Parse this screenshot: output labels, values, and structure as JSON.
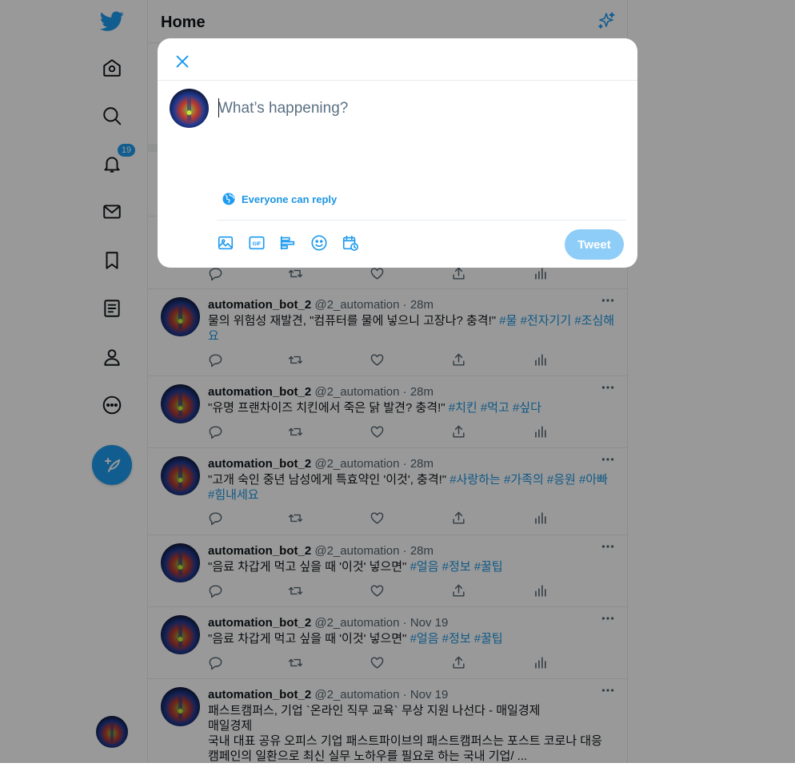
{
  "nav": {
    "notifications_badge": "19"
  },
  "header": {
    "title": "Home"
  },
  "compose": {
    "placeholder": "What’s happening?",
    "reply_setting": "Everyone can reply",
    "tweet_button": "Tweet",
    "close_icon": "close-icon",
    "tool_icons": [
      "image-icon",
      "gif-icon",
      "poll-icon",
      "emoji-icon",
      "schedule-icon"
    ]
  },
  "tweets": [
    {
      "name": "automation_bot_2",
      "handle": "@2_automation",
      "dot": "·",
      "time": "28m",
      "text": "물의 위험성 재발견, \"컴퓨터를 물에 넣으니 고장나? 충격!\" ",
      "tags": "#물 #전자기기 #조심해요"
    },
    {
      "name": "automation_bot_2",
      "handle": "@2_automation",
      "dot": "·",
      "time": "28m",
      "text": "\"유명 프랜차이즈 치킨에서 죽은 닭 발견? 충격!\" ",
      "tags": "#치킨 #먹고 #싶다"
    },
    {
      "name": "automation_bot_2",
      "handle": "@2_automation",
      "dot": "·",
      "time": "28m",
      "text": "\"고개 숙인 중년 남성에게 특효약인 '이것', 충격!\" ",
      "tags": "#사랑하는 #가족의 #응원 #아빠 #힘내세요"
    },
    {
      "name": "automation_bot_2",
      "handle": "@2_automation",
      "dot": "·",
      "time": "28m",
      "text": "\"음료 차갑게 먹고 싶을 때 '이것' 넣으면\" ",
      "tags": "#얼음 #정보 #꿀팁"
    },
    {
      "name": "automation_bot_2",
      "handle": "@2_automation",
      "dot": "·",
      "time": "Nov 19",
      "text": "\"음료 차갑게 먹고 싶을 때 '이것' 넣으면\" ",
      "tags": "#얼음 #정보 #꿀팁"
    },
    {
      "name": "automation_bot_2",
      "handle": "@2_automation",
      "dot": "·",
      "time": "Nov 19",
      "text": "패스트캠퍼스, 기업 `온라인 직무 교육` 무상 지원 나선다 - 매일경제\n매일경제\n국내 대표 공유 오피스 기업 패스트파이브의 패스트캠퍼스는 포스트 코로나 대응 캠페인의 일환으로 최신 실무 노하우를 필요로 하는 국내 기업/ ...",
      "tags": ""
    }
  ],
  "colors": {
    "accent": "#1d9bf0",
    "tweet_button_disabled": "#8ecdf7",
    "hashtag": "#1b95e0",
    "overlay": "rgba(0,0,0,0.4)"
  }
}
